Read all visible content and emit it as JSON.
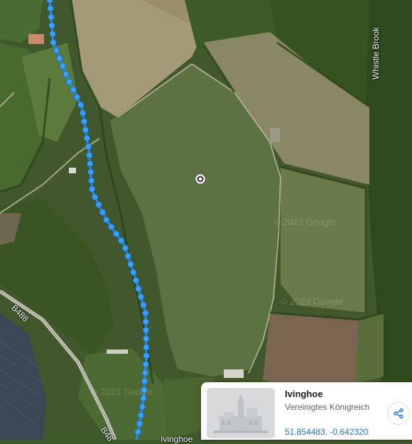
{
  "map": {
    "watermark": "© 2023 Google",
    "labels": {
      "whistle_brook": "Whistle Brook",
      "b488_upper": "B488",
      "b488_lower": "B48",
      "ivinghoe_partial": "Ivinghoe"
    },
    "colors": {
      "route": "#2a8cf0",
      "route_dot": "#3aa0ff"
    }
  },
  "place_card": {
    "title": "Ivinghoe",
    "subtitle": "Vereinigtes Königreich",
    "coordinates": "51.854483, -0.642320",
    "share_icon": "share-icon"
  }
}
